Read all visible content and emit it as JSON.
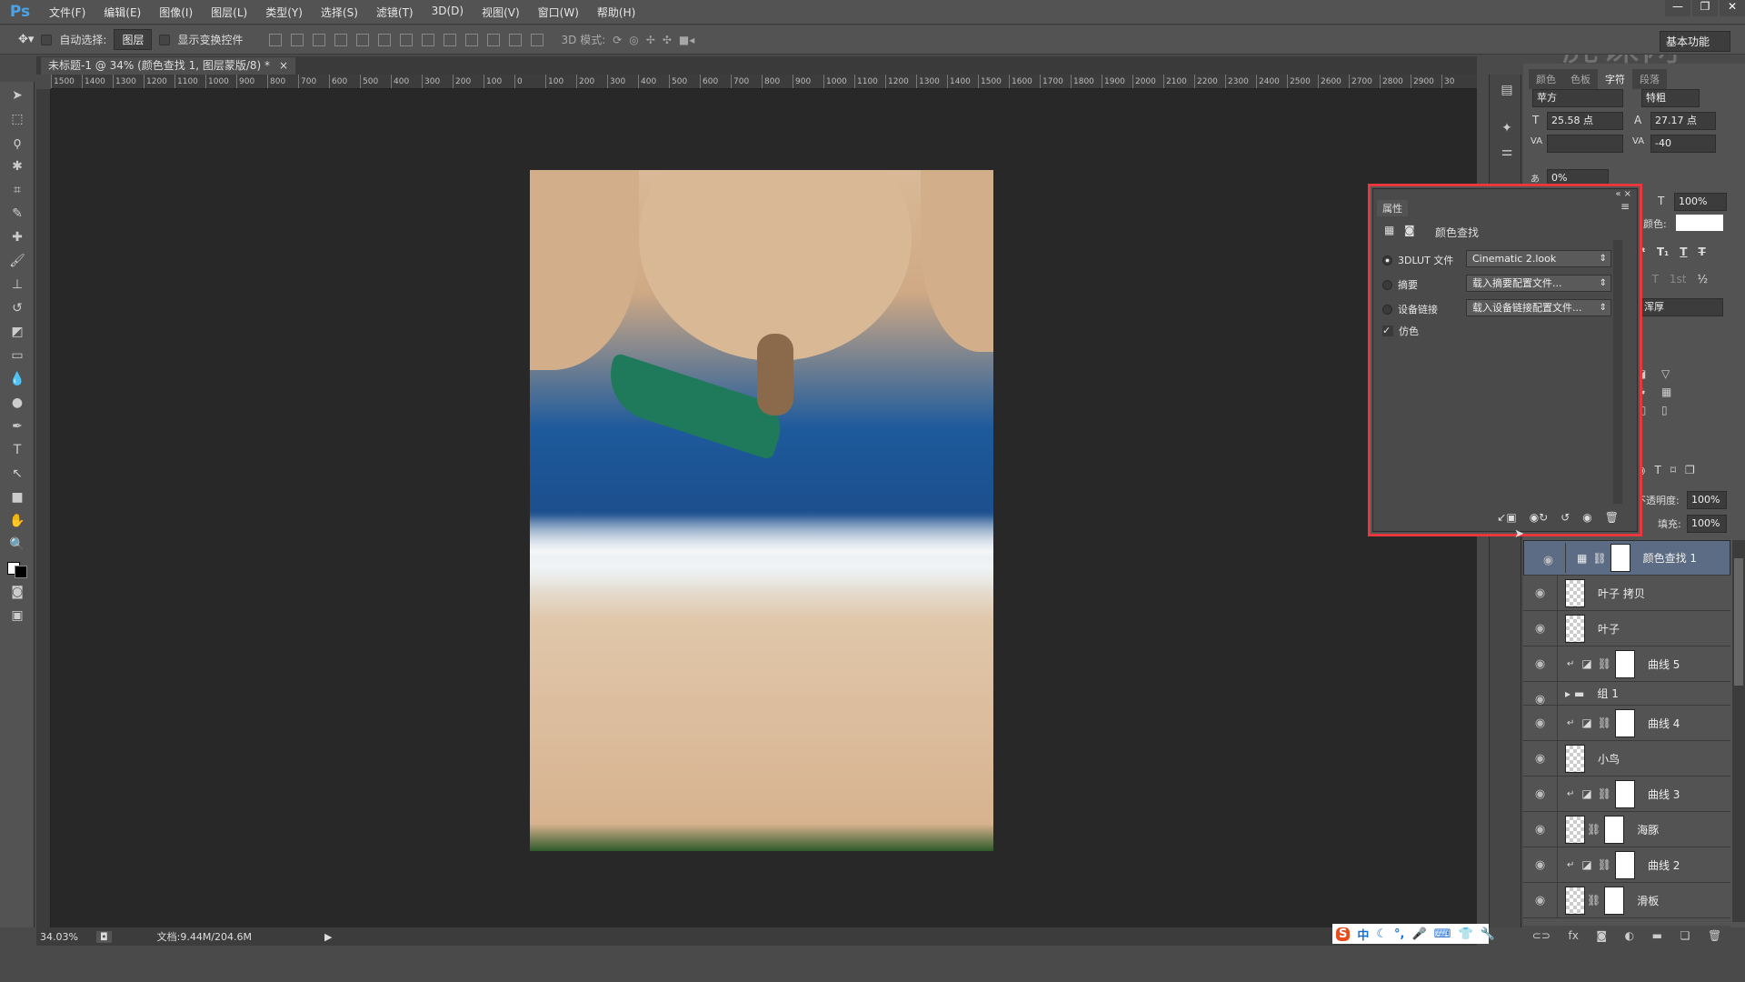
{
  "app": {
    "logo": "Ps",
    "menus": [
      "文件(F)",
      "编辑(E)",
      "图像(I)",
      "图层(L)",
      "类型(Y)",
      "选择(S)",
      "滤镜(T)",
      "3D(D)",
      "视图(V)",
      "窗口(W)",
      "帮助(H)"
    ],
    "window_controls": [
      "—",
      "❐",
      "✕"
    ]
  },
  "options": {
    "auto_select_label": "自动选择:",
    "auto_select_value": "图层",
    "show_transform_label": "显示变换控件",
    "mode_3d_label": "3D 模式:",
    "workspace": "基本功能"
  },
  "watermark": "虎课网",
  "document": {
    "tab_title": "未标题-1 @ 34% (颜色查找 1, 图层蒙版/8) *",
    "close": "×"
  },
  "ruler_labels": [
    "1500",
    "1400",
    "1300",
    "1200",
    "1100",
    "1000",
    "900",
    "800",
    "700",
    "600",
    "500",
    "400",
    "300",
    "200",
    "100",
    "0",
    "100",
    "200",
    "300",
    "400",
    "500",
    "600",
    "700",
    "800",
    "900",
    "1000",
    "1100",
    "1200",
    "1300",
    "1400",
    "1500",
    "1600",
    "1700",
    "1800",
    "1900",
    "2000",
    "2100",
    "2200",
    "2300",
    "2400",
    "2500",
    "2600",
    "2700",
    "2800",
    "2900",
    "30"
  ],
  "status": {
    "zoom": "34.03%",
    "doc": "文档:9.44M/204.6M"
  },
  "character_panel": {
    "tabs": [
      "颜色",
      "色板",
      "字符",
      "段落"
    ],
    "active_tab": "字符",
    "font_family": "苹方",
    "font_style": "特粗",
    "font_size": "25.58 点",
    "leading": "27.17 点",
    "kerning": "",
    "tracking": "-40",
    "scale": "0%",
    "vertical_scale": "100%",
    "color_label": "颜色:",
    "color": "#ffffff",
    "antialias": "浑厚"
  },
  "properties": {
    "tab": "属性",
    "title": "颜色查找",
    "rows": [
      {
        "label": "3DLUT 文件",
        "value": "Cinematic 2.look",
        "selected": true
      },
      {
        "label": "摘要",
        "value": "载入摘要配置文件...",
        "selected": false
      },
      {
        "label": "设备链接",
        "value": "载入设备链接配置文件...",
        "selected": false
      }
    ],
    "dither_label": "仿色",
    "dither_checked": true
  },
  "layers_panel": {
    "opacity_label": "不透明度:",
    "opacity": "100%",
    "fill_label": "填充:",
    "fill": "100%",
    "layers": [
      {
        "name": "颜色查找 1",
        "type": "adjustment",
        "selected": true
      },
      {
        "name": "叶子 拷贝",
        "type": "smart"
      },
      {
        "name": "叶子",
        "type": "smart"
      },
      {
        "name": "曲线 5",
        "type": "curves"
      },
      {
        "name": "组 1",
        "type": "group"
      },
      {
        "name": "曲线 4",
        "type": "curves"
      },
      {
        "name": "小鸟",
        "type": "smart"
      },
      {
        "name": "曲线 3",
        "type": "curves"
      },
      {
        "name": "海豚",
        "type": "smart-mask"
      },
      {
        "name": "曲线 2",
        "type": "curves"
      },
      {
        "name": "滑板",
        "type": "smart-mask"
      }
    ]
  },
  "ime": {
    "logo": "S",
    "mode": "中"
  },
  "colors": {
    "highlight": "#e8373d",
    "selected_layer": "#5c6c84"
  }
}
